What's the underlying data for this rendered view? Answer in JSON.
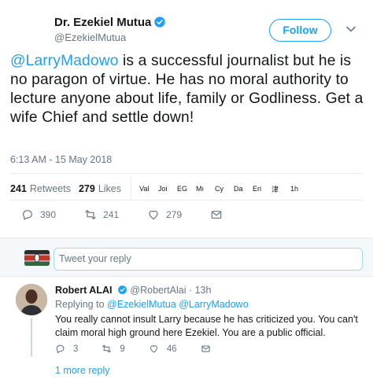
{
  "tweet": {
    "author_name": "Dr. Ezekiel Mutua",
    "author_handle": "@EzekielMutua",
    "follow_label": "Follow",
    "mention": "@LarryMadowo",
    "body": " is a successful journalist but he is no paragon of virtue. He has no moral authority to lecture anyone about life, family or Godliness. Get a wife Chief and settle down!",
    "timestamp": "6:13 AM - 15 May 2018",
    "retweet_count": "241",
    "retweet_label": "Retweets",
    "like_count": "279",
    "like_label": "Likes",
    "likers": [
      "Val",
      "Joi",
      "EG",
      "Mı",
      "Cy",
      "Da",
      "Eri",
      "津",
      "1h"
    ],
    "actions": {
      "reply_count": "390",
      "retweet_count": "241",
      "like_count": "279"
    }
  },
  "reply_bar": {
    "placeholder": "Tweet your reply"
  },
  "reply": {
    "author_name": "Robert ALAI",
    "author_handle": "@RobertAlai",
    "time": "· 13h",
    "replying_label": "Replying to",
    "replying_to": "@EzekielMutua @LarryMadowo",
    "body": "You really cannot insult Larry because he has criticized you. You can't claim moral high ground here Ezekiel. You are a public official.",
    "reply_count": "3",
    "retweet_count": "9",
    "like_count": "46",
    "more_replies": "1 more reply"
  },
  "colors": {
    "accent": "#1da1f2",
    "text": "#14171a",
    "muted": "#657786",
    "verified": "#1da1f2"
  }
}
